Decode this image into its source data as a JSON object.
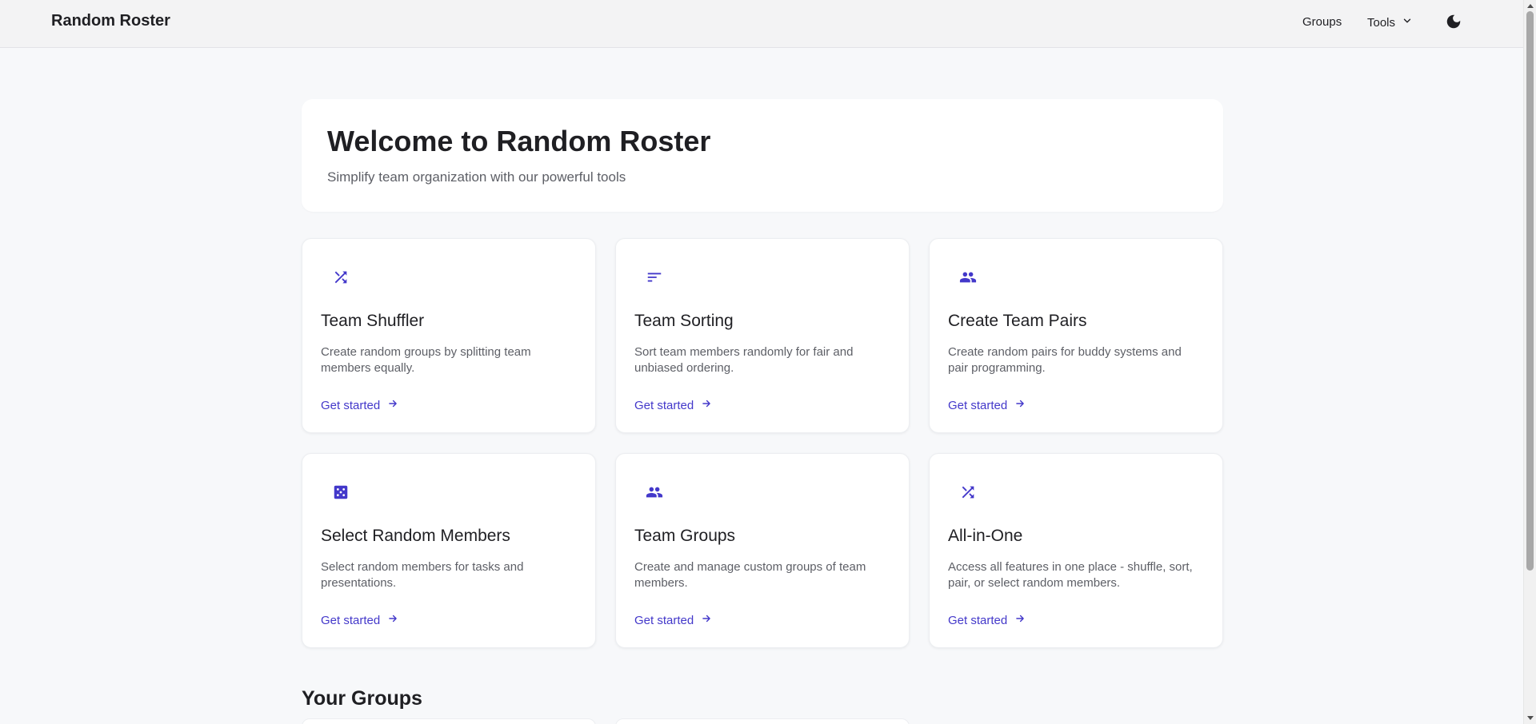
{
  "header": {
    "brand": "Random Roster",
    "nav": {
      "groups": "Groups",
      "tools": "Tools"
    },
    "theme_icon": "moon-icon"
  },
  "hero": {
    "title": "Welcome to Random Roster",
    "subtitle": "Simplify team organization with our powerful tools"
  },
  "cards": [
    {
      "icon": "shuffle-icon",
      "title": "Team Shuffler",
      "description": "Create random groups by splitting team members equally.",
      "link": "Get started"
    },
    {
      "icon": "sort-icon",
      "title": "Team Sorting",
      "description": "Sort team members randomly for fair and unbiased ordering.",
      "link": "Get started"
    },
    {
      "icon": "people-icon",
      "title": "Create Team Pairs",
      "description": "Create random pairs for buddy systems and pair programming.",
      "link": "Get started"
    },
    {
      "icon": "dice-icon",
      "title": "Select Random Members",
      "description": "Select random members for tasks and presentations.",
      "link": "Get started"
    },
    {
      "icon": "people-icon",
      "title": "Team Groups",
      "description": "Create and manage custom groups of team members.",
      "link": "Get started"
    },
    {
      "icon": "shuffle-icon",
      "title": "All-in-One",
      "description": "Access all features in one place - shuffle, sort, pair, or select random members.",
      "link": "Get started"
    }
  ],
  "your_groups": {
    "title": "Your Groups"
  },
  "colors": {
    "accent": "#4338ca",
    "background": "#f7f8fa",
    "card": "#ffffff"
  }
}
